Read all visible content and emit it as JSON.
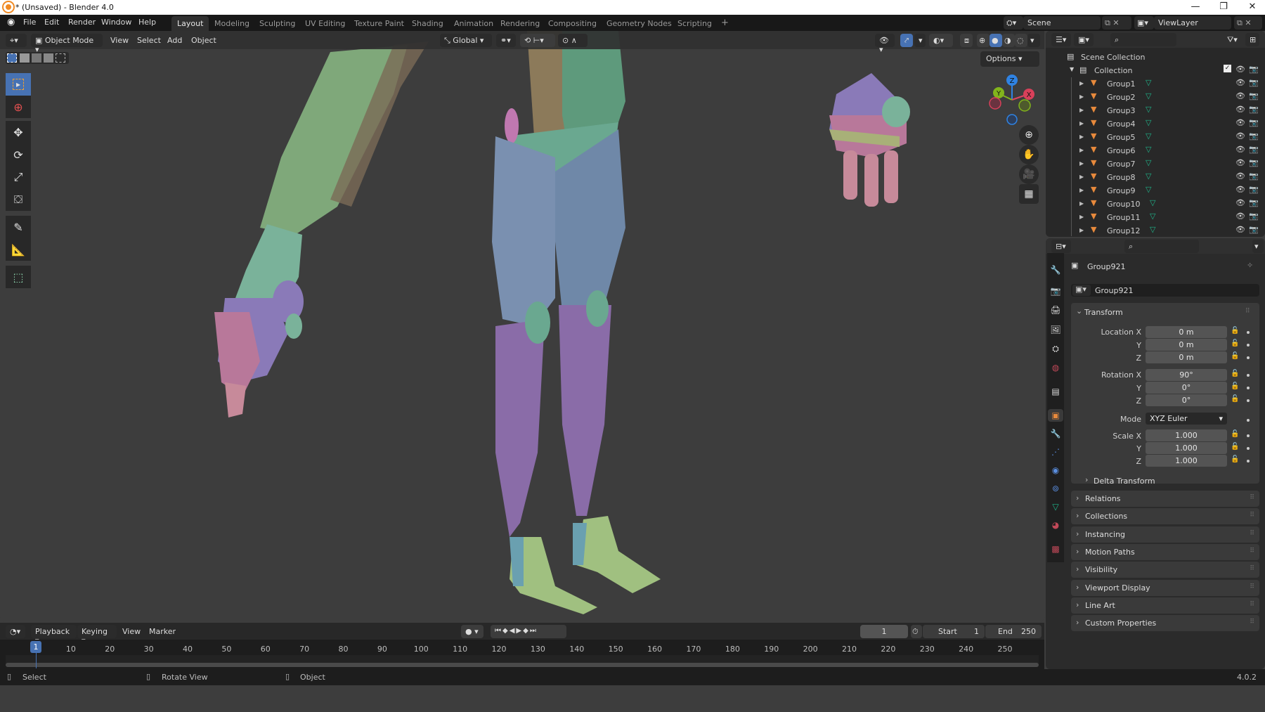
{
  "window": {
    "title": "* (Unsaved) - Blender 4.0",
    "controls": [
      "minimize",
      "maximize",
      "close"
    ]
  },
  "menubar": {
    "menus": [
      "File",
      "Edit",
      "Render",
      "Window",
      "Help"
    ],
    "workspaces": [
      "Layout",
      "Modeling",
      "Sculpting",
      "UV Editing",
      "Texture Paint",
      "Shading",
      "Animation",
      "Rendering",
      "Compositing",
      "Geometry Nodes",
      "Scripting"
    ],
    "active_workspace": "Layout",
    "add_workspace": "+",
    "scene": "Scene",
    "view_layer": "ViewLayer"
  },
  "viewport": {
    "mode": "Object Mode",
    "menus": [
      "View",
      "Select",
      "Add",
      "Object"
    ],
    "transform_orientation": "Global",
    "options_label": "Options",
    "gizmo_axes": [
      "Z",
      "Y",
      "X"
    ],
    "shading_active": "solid",
    "tools": [
      "select-box",
      "cursor",
      "move",
      "rotate",
      "scale",
      "transform",
      "annotate",
      "measure",
      "add-cube"
    ],
    "nav_buttons": [
      "zoom",
      "pan",
      "camera",
      "ortho-grid"
    ],
    "accent": "#4772b3"
  },
  "timeline": {
    "menus": [
      "Playback",
      "Keying",
      "View",
      "Marker"
    ],
    "current_frame": "1",
    "start_label": "Start",
    "start": "1",
    "end_label": "End",
    "end": "250",
    "ticks": [
      "10",
      "20",
      "30",
      "40",
      "50",
      "60",
      "70",
      "80",
      "90",
      "100",
      "110",
      "120",
      "130",
      "140",
      "150",
      "160",
      "170",
      "180",
      "190",
      "200",
      "210",
      "220",
      "230",
      "240",
      "250"
    ],
    "playhead": "1"
  },
  "statusbar": {
    "hints": [
      "Select",
      "Rotate View",
      "Object"
    ],
    "version": "4.0.2"
  },
  "outliner": {
    "root": "Scene Collection",
    "collection": "Collection",
    "items": [
      "Group1",
      "Group2",
      "Group3",
      "Group4",
      "Group5",
      "Group6",
      "Group7",
      "Group8",
      "Group9",
      "Group10",
      "Group11",
      "Group12"
    ]
  },
  "properties": {
    "object_name": "Group921",
    "datablock_name": "Group921",
    "transform": {
      "title": "Transform",
      "location_label": "Location X",
      "location": [
        "0 m",
        "0 m",
        "0 m"
      ],
      "rotation_label": "Rotation X",
      "rotation": [
        "90°",
        "0°",
        "0°"
      ],
      "mode_label": "Mode",
      "mode": "XYZ Euler",
      "scale_label": "Scale X",
      "scale": [
        "1.000",
        "1.000",
        "1.000"
      ],
      "axis_y": "Y",
      "axis_z": "Z",
      "delta": "Delta Transform"
    },
    "panels": [
      "Relations",
      "Collections",
      "Instancing",
      "Motion Paths",
      "Visibility",
      "Viewport Display",
      "Line Art",
      "Custom Properties"
    ]
  }
}
